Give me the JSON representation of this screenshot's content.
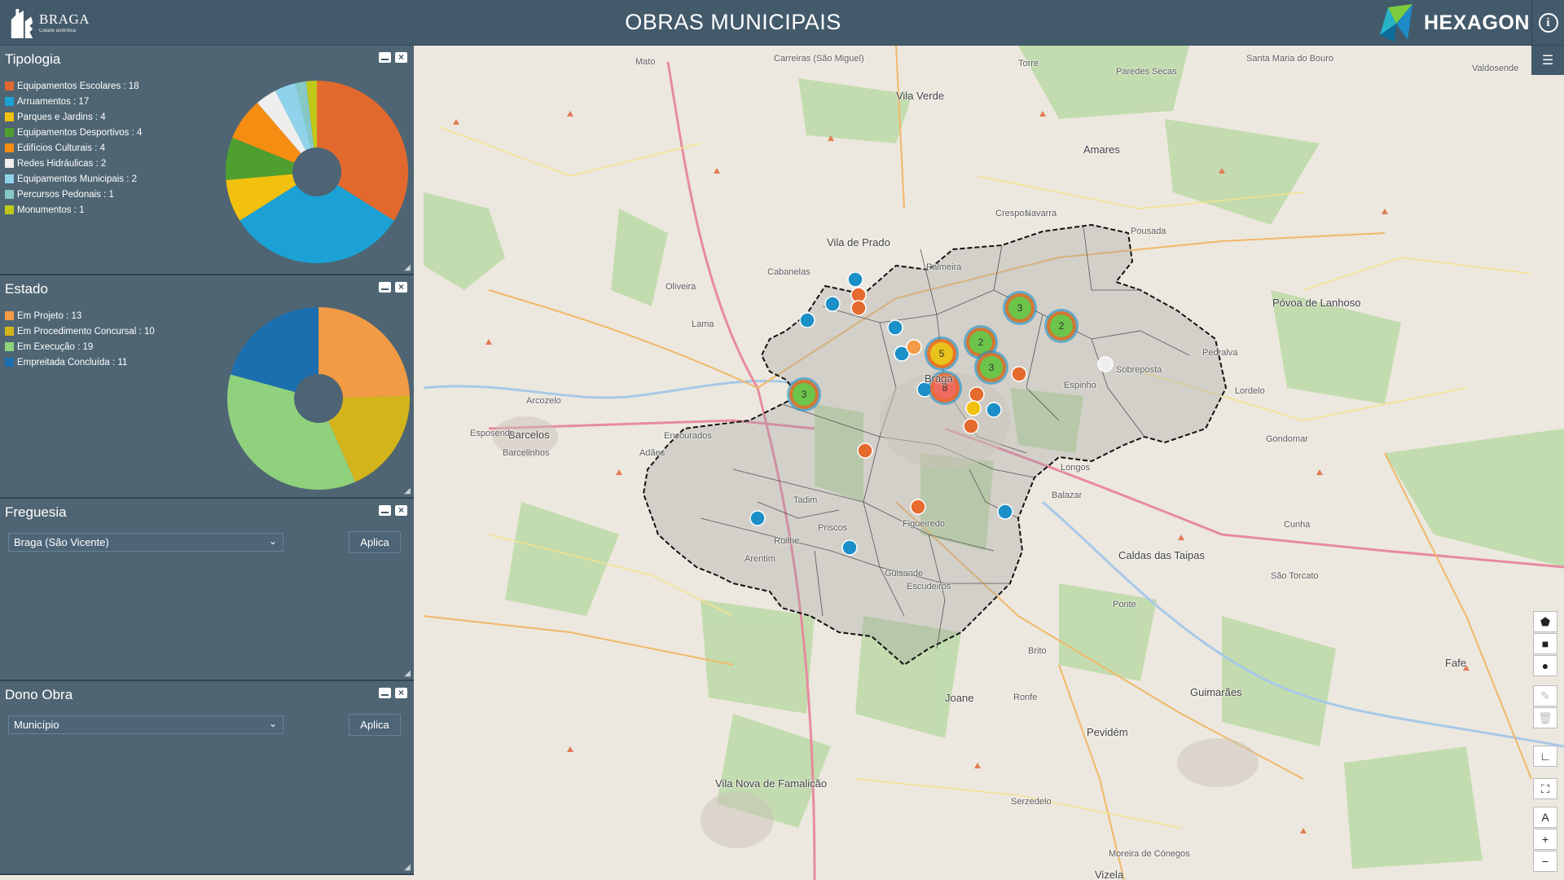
{
  "header": {
    "brand_name": "BRAGA",
    "brand_sub": "Cidade autêntica",
    "title": "OBRAS MUNICIPAIS",
    "vendor": "HEXAGON",
    "info_icon": "info-icon"
  },
  "panels": {
    "tipologia": {
      "title": "Tipologia",
      "chart_data": {
        "type": "pie",
        "donut": true,
        "categories": [
          "Equipamentos Escolares",
          "Arruamentos",
          "Parques e Jardins",
          "Equipamentos Desportivos",
          "Edifícios Culturais",
          "Redes Hidráulicas",
          "Equipamentos Municipais",
          "Percursos Pedonais",
          "Monumentos"
        ],
        "values": [
          18,
          17,
          4,
          4,
          4,
          2,
          2,
          1,
          1
        ],
        "labels": [
          "Equipamentos Escolares : 18",
          "Arruamentos : 17",
          "Parques e Jardins : 4",
          "Equipamentos Desportivos : 4",
          "Edifícios Culturais : 4",
          "Redes Hidráulicas : 2",
          "Equipamentos Municipais : 2",
          "Percursos Pedonais : 1",
          "Monumentos : 1"
        ],
        "colors": [
          "#e2692e",
          "#1ba1d4",
          "#f2c00f",
          "#4e9f2f",
          "#f58d12",
          "#eeeeee",
          "#8fd3ea",
          "#85c8c5",
          "#c0c91a"
        ],
        "legend": "left"
      }
    },
    "estado": {
      "title": "Estado",
      "chart_data": {
        "type": "pie",
        "donut": true,
        "categories": [
          "Em Projeto",
          "Em Procedimento Concursal",
          "Em Execução",
          "Empreitada Concluída"
        ],
        "values": [
          13,
          10,
          19,
          11
        ],
        "labels": [
          "Em Projeto : 13",
          "Em Procedimento Concursal : 10",
          "Em Execução : 19",
          "Empreitada Concluída : 11"
        ],
        "colors": [
          "#f29a45",
          "#d4b41b",
          "#8fd17c",
          "#1c6fae"
        ],
        "legend": "left"
      }
    },
    "freguesia": {
      "title": "Freguesia",
      "selected": "Braga (São Vicente)",
      "apply_label": "Aplica"
    },
    "dono_obra": {
      "title": "Dono Obra",
      "selected": "Município",
      "apply_label": "Aplica"
    }
  },
  "map": {
    "places": [
      {
        "name": "Mato"
      },
      {
        "name": "Carreiras (São Miguel)"
      },
      {
        "name": "Vila Verde",
        "big": true
      },
      {
        "name": "Torre"
      },
      {
        "name": "Paredes Secas"
      },
      {
        "name": "Santa Maria do Bouro"
      },
      {
        "name": "Valdosende"
      },
      {
        "name": "Amares",
        "big": true
      },
      {
        "name": "Vila de Prado",
        "big": true
      },
      {
        "name": "Cabanelas"
      },
      {
        "name": "Palmeira"
      },
      {
        "name": "Crespos"
      },
      {
        "name": "Navarra"
      },
      {
        "name": "Pousada"
      },
      {
        "name": "Póvoa de Lanhoso",
        "big": true
      },
      {
        "name": "Lama"
      },
      {
        "name": "Oliveira"
      },
      {
        "name": "Arcozelo"
      },
      {
        "name": "Barcelos",
        "big": true
      },
      {
        "name": "Barcelinhos"
      },
      {
        "name": "Esposende"
      },
      {
        "name": "Encourados"
      },
      {
        "name": "Adães"
      },
      {
        "name": "Braga",
        "big": true
      },
      {
        "name": "Espinho"
      },
      {
        "name": "Sobreposta"
      },
      {
        "name": "Pedralva"
      },
      {
        "name": "Longos"
      },
      {
        "name": "Balazar"
      },
      {
        "name": "Caldas das Taipas",
        "big": true
      },
      {
        "name": "Ponte"
      },
      {
        "name": "Brito"
      },
      {
        "name": "Guimarães",
        "big": true
      },
      {
        "name": "São Torcato"
      },
      {
        "name": "Joane",
        "big": true
      },
      {
        "name": "Ronfe"
      },
      {
        "name": "Pevidém",
        "big": true
      },
      {
        "name": "Vila Nova de Famalicão",
        "big": true
      },
      {
        "name": "Serzedelo"
      },
      {
        "name": "Moreira de Cónegos"
      },
      {
        "name": "Vizela",
        "big": true
      },
      {
        "name": "Fafe",
        "big": true
      },
      {
        "name": "Gondomar"
      },
      {
        "name": "Lordelo"
      },
      {
        "name": "Cunha"
      },
      {
        "name": "Ruilhe"
      },
      {
        "name": "Arentim"
      },
      {
        "name": "Escudeiros"
      },
      {
        "name": "Guisande"
      },
      {
        "name": "Tadim"
      },
      {
        "name": "Priscos"
      },
      {
        "name": "Figueiredo"
      }
    ],
    "clusters": [
      {
        "count": "3",
        "color": "#6cc54a"
      },
      {
        "count": "2",
        "color": "#6cc54a"
      },
      {
        "count": "2",
        "color": "#6cc54a"
      },
      {
        "count": "5",
        "color": "#e9c21c"
      },
      {
        "count": "3",
        "color": "#6cc54a"
      },
      {
        "count": "8",
        "color": "#ef6b5e"
      },
      {
        "count": "3",
        "color": "#6cc54a"
      }
    ]
  },
  "tools": {
    "menu_icon": "hamburger-menu-icon",
    "polygon_icon": "polygon-draw-icon",
    "square_icon": "rectangle-draw-icon",
    "circle_icon": "circle-draw-icon",
    "edit_icon": "edit-icon",
    "delete_icon": "trash-icon",
    "measure_icon": "measure-icon",
    "fullscreen_icon": "fullscreen-icon",
    "north_icon": "north-arrow-icon",
    "zoom_in": "+",
    "zoom_out": "−"
  }
}
